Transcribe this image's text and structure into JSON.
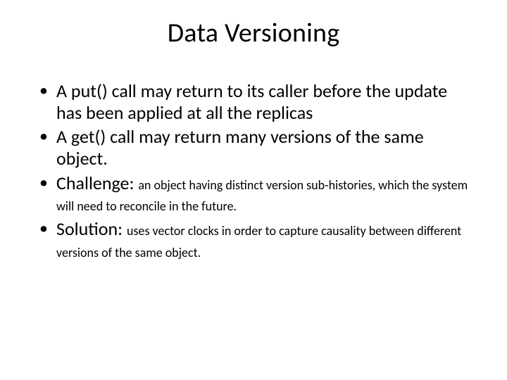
{
  "title": "Data Versioning",
  "bullets": {
    "b1": "A put() call may return to its caller before the update has been applied at all the replicas",
    "b2": "A get() call may return many versions of the same object.",
    "b3_lead": "Challenge: ",
    "b3_rest": "an object having distinct version sub-histories, which the system will need to reconcile in the future.",
    "b4_lead": "Solution: ",
    "b4_rest": "uses vector clocks in order to capture causality between different versions of the same object."
  }
}
